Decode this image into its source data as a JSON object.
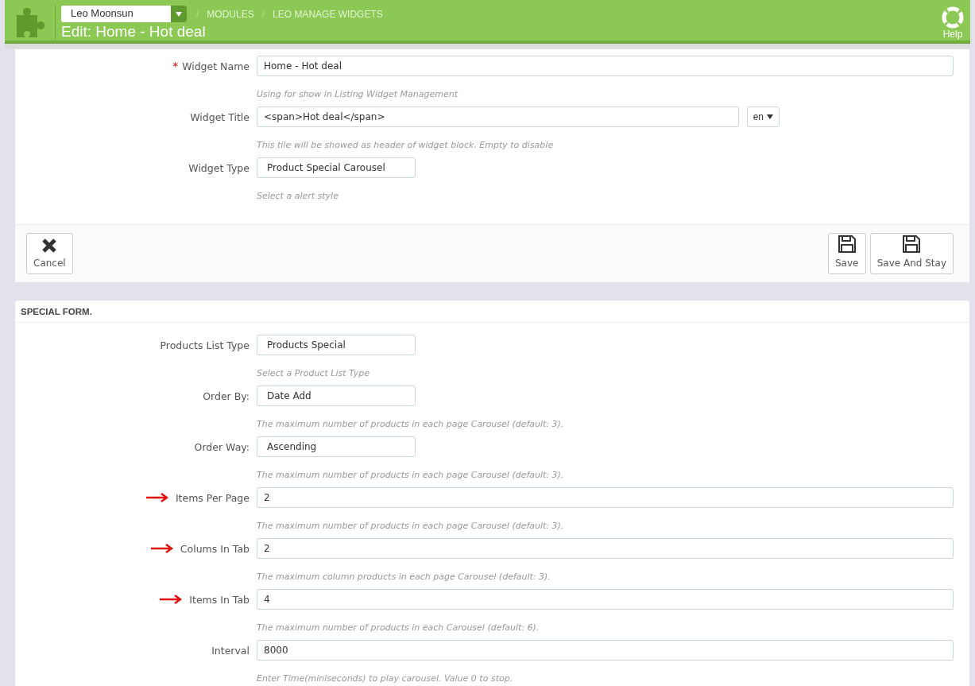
{
  "header": {
    "shop_selector": "Leo Moonsun",
    "breadcrumbs": [
      {
        "separator": "/",
        "label": "MODULES"
      },
      {
        "separator": "/",
        "label": "LEO MANAGE WIDGETS"
      }
    ],
    "title": "Edit: Home - Hot deal",
    "help": "Help"
  },
  "widget_form": {
    "fields": [
      {
        "kind": "text",
        "label": "Widget Name",
        "required_mark": "*",
        "value": "Home - Hot deal",
        "hint": "Using for show in Listing Widget Management"
      },
      {
        "kind": "lang",
        "label": "Widget Title",
        "value": "<span>Hot deal</span>",
        "language": "en",
        "hint": "This tile will be showed as header of widget block. Empty to disable"
      },
      {
        "kind": "select",
        "label": "Widget Type",
        "value": "Product Special Carousel",
        "hint": "Select a alert style"
      }
    ],
    "buttons": [
      {
        "kind": "cancel",
        "label": "Cancel"
      },
      {
        "kind": "save",
        "label": "Save"
      },
      {
        "kind": "save",
        "label": "Save And Stay"
      }
    ]
  },
  "special_form": {
    "title": "SPECIAL FORM.",
    "fields": [
      {
        "kind": "select",
        "label": "Products List Type",
        "highlighted": false,
        "value": "Products Special",
        "hint": "Select a Product List Type"
      },
      {
        "kind": "select",
        "label": "Order By:",
        "highlighted": false,
        "value": "Date Add",
        "hint": "The maximum number of products in each page Carousel (default: 3)."
      },
      {
        "kind": "select",
        "label": "Order Way:",
        "highlighted": false,
        "value": "Ascending",
        "hint": "The maximum number of products in each page Carousel (default: 3)."
      },
      {
        "kind": "text",
        "label": "Items Per Page",
        "highlighted": true,
        "value": "2",
        "hint": "The maximum number of products in each page Carousel (default: 3)."
      },
      {
        "kind": "text",
        "label": "Colums In Tab",
        "highlighted": true,
        "value": "2",
        "hint": "The maximum column products in each page Carousel (default: 3)."
      },
      {
        "kind": "text",
        "label": "Items In Tab",
        "highlighted": true,
        "value": "4",
        "hint": "The maximum number of products in each Carousel (default: 6)."
      },
      {
        "kind": "text",
        "label": "Interval",
        "highlighted": false,
        "value": "8000",
        "hint": "Enter Time(miniseconds) to play carousel. Value 0 to stop."
      }
    ]
  }
}
